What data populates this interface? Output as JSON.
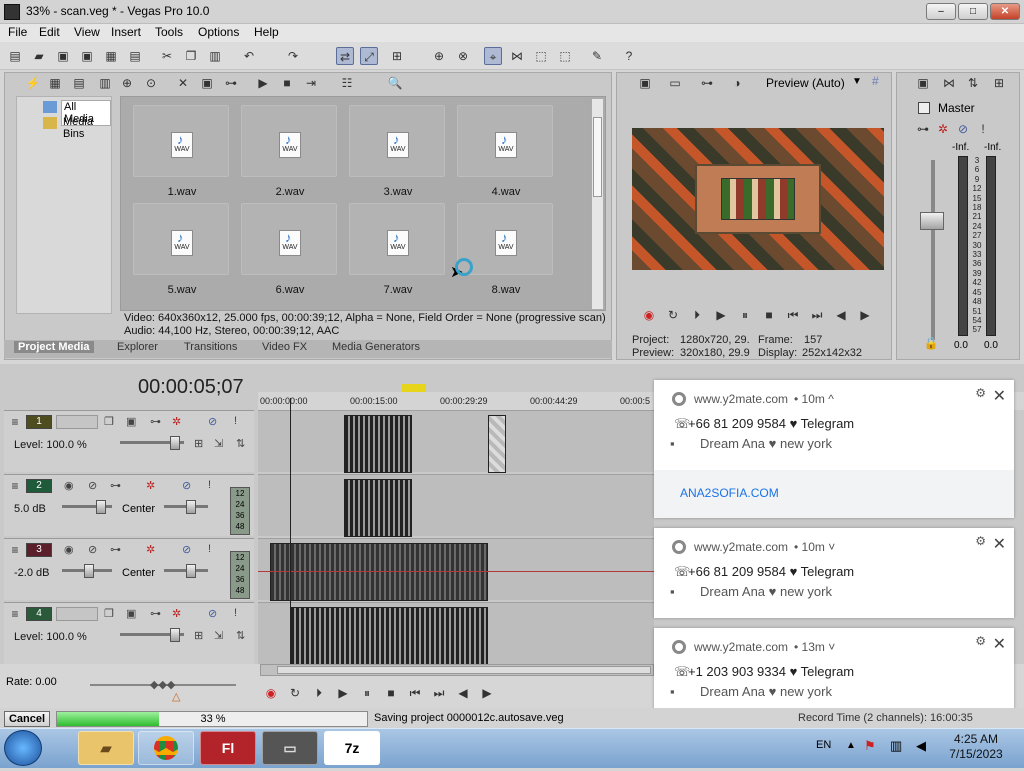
{
  "window": {
    "title": "33% - scan.veg * - Vegas Pro 10.0",
    "min": "–",
    "max": "□",
    "close": "✕"
  },
  "menu": [
    "File",
    "Edit",
    "View",
    "Insert",
    "Tools",
    "Options",
    "Help"
  ],
  "explorer": {
    "tree": [
      "All Media",
      "Media Bins"
    ],
    "files": [
      "1.wav",
      "2.wav",
      "3.wav",
      "4.wav",
      "5.wav",
      "6.wav",
      "7.wav",
      "8.wav"
    ],
    "wav_badge": "WAV",
    "info_line1": "Video: 640x360x12, 25.000 fps, 00:00:39;12, Alpha = None, Field Order = None (progressive scan)",
    "info_line2": "Audio: 44,100 Hz, Stereo, 00:00:39;12, AAC",
    "tabs": [
      "Project Media",
      "Explorer",
      "Transitions",
      "Video FX",
      "Media Generators"
    ]
  },
  "preview": {
    "mode": "Preview (Auto)",
    "project_label": "Project:",
    "project_value": "1280x720, 29.",
    "frame_label": "Frame:",
    "frame_value": "157",
    "preview_label": "Preview:",
    "preview_value": "320x180, 29.9",
    "display_label": "Display:",
    "display_value": "252x142x32"
  },
  "mixer": {
    "title": "Master",
    "inf_left": "-Inf.",
    "inf_right": "-Inf.",
    "scale": [
      "3",
      "6",
      "9",
      "12",
      "15",
      "18",
      "21",
      "24",
      "27",
      "30",
      "33",
      "36",
      "39",
      "42",
      "45",
      "48",
      "51",
      "54",
      "57"
    ],
    "bottom_left": "0.0",
    "bottom_right": "0.0"
  },
  "timeline": {
    "timecode": "00:00:05;07",
    "ruler": [
      "00:00:00:00",
      "00:00:15:00",
      "00:00:29:29",
      "00:00:44:29",
      "00:00:5"
    ],
    "meter_ticks": [
      "12",
      "24",
      "36",
      "48"
    ],
    "tracks": [
      {
        "num": "1",
        "color": "#4d4d1f",
        "info": "Level: 100.0 %",
        "pan": ""
      },
      {
        "num": "2",
        "color": "#1f5a3a",
        "info": "5.0 dB",
        "pan": "Center"
      },
      {
        "num": "3",
        "color": "#5a1f2a",
        "info": "-2.0 dB",
        "pan": "Center"
      },
      {
        "num": "4",
        "color": "#2a5a3a",
        "info": "Level: 100.0 %",
        "pan": ""
      }
    ],
    "rate": "Rate: 0.00"
  },
  "notifications": [
    {
      "source": "www.y2mate.com",
      "age": "• 10m ^",
      "line1": "+66 81 209 9584 ♥ Telegram",
      "line2": "Dream Ana ♥ new york",
      "link": "ANA2SOFIA.COM"
    },
    {
      "source": "www.y2mate.com",
      "age": "• 10m ˅",
      "line1": "+66 81 209 9584 ♥ Telegram",
      "line2": "Dream Ana ♥ new york"
    },
    {
      "source": "www.y2mate.com",
      "age": "• 13m ˅",
      "line1": "+1 203 903 9334 ♥ Telegram",
      "line2": "Dream Ana ♥ new york"
    }
  ],
  "status": {
    "cancel": "Cancel",
    "progress_label": "33 %",
    "progress": 0.33,
    "message": "Saving project 0000012c.autosave.veg",
    "record_time": "Record Time (2 channels): 16:00:35"
  },
  "taskbar": {
    "lang": "EN",
    "time": "4:25 AM",
    "date": "7/15/2023",
    "apps": [
      "Explorer",
      "Chrome",
      "Fl",
      "Vegas",
      "7z"
    ]
  },
  "colors": {
    "progress": "#2fbd2f",
    "link": "#1a73e8",
    "accent": "#5b6e9a"
  }
}
